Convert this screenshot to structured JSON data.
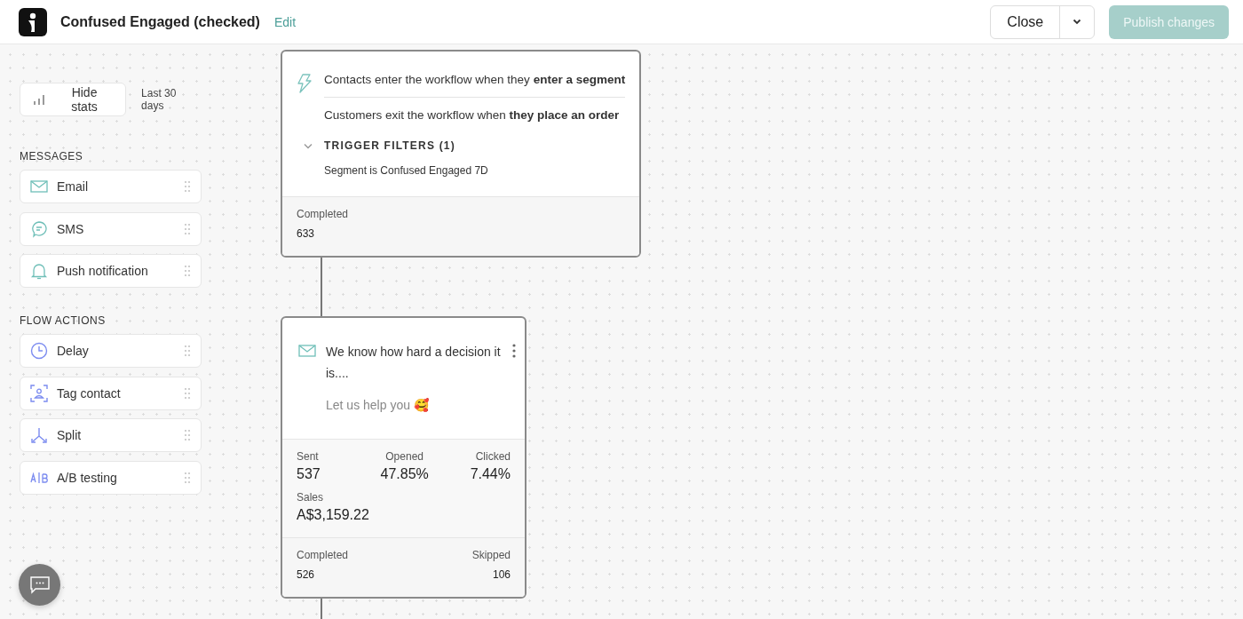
{
  "header": {
    "title": "Confused Engaged (checked)",
    "edit_link": "Edit",
    "close_button": "Close",
    "publish_button": {
      "label": "Publish changes",
      "disabled": true
    }
  },
  "sidebar": {
    "hide_stats": "Hide stats",
    "period": "Last 30 days",
    "sections": [
      {
        "heading": "MESSAGES",
        "items": [
          {
            "label": "Email",
            "kind": "email"
          },
          {
            "label": "SMS",
            "kind": "sms"
          },
          {
            "label": "Push notification",
            "kind": "push"
          }
        ]
      },
      {
        "heading": "FLOW ACTIONS",
        "items": [
          {
            "label": "Delay",
            "kind": "delay"
          },
          {
            "label": "Tag contact",
            "kind": "tag"
          },
          {
            "label": "Split",
            "kind": "split"
          },
          {
            "label": "A/B testing",
            "kind": "ab"
          }
        ]
      }
    ]
  },
  "trigger_card": {
    "entry": "Contacts enter the workflow when they **enter a segment**",
    "exit": "Customers exit the workflow when **they place an order**",
    "filters": {
      "title": "TRIGGER FILTERS (1)",
      "expanded": true,
      "items": [
        "Segment is Confused Engaged 7D"
      ]
    },
    "footer": [
      {
        "label": "Completed",
        "value": "633"
      }
    ]
  },
  "email_card": {
    "subject": "We know how hard a decision it is....",
    "preview": "Let us help you 🥰",
    "stats": [
      {
        "label": "Sent",
        "value": "537"
      },
      {
        "label": "Opened",
        "value": "47.85%"
      },
      {
        "label": "Clicked",
        "value": "7.44%"
      },
      {
        "label": "Sales",
        "value": "A$3,159.22"
      }
    ],
    "footer": [
      {
        "label": "Completed",
        "value": "526"
      },
      {
        "label": "Skipped",
        "value": "106"
      }
    ]
  }
}
